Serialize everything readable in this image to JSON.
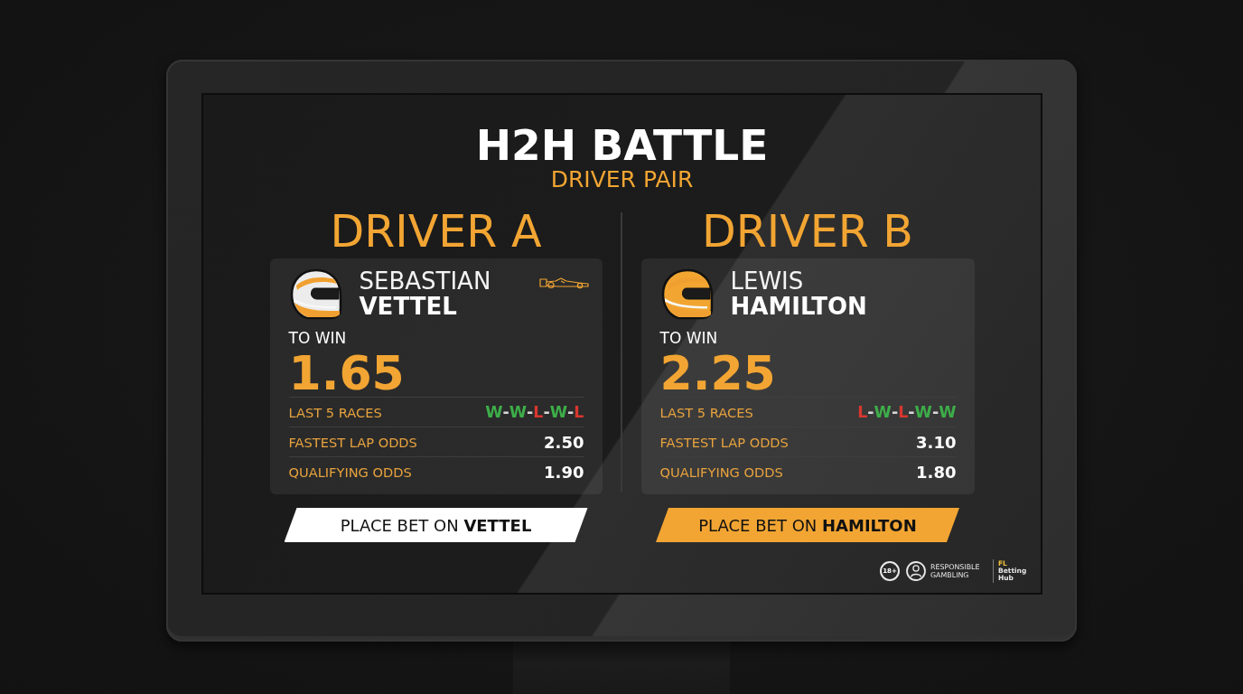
{
  "title": "H2H BATTLE",
  "subtitle": "DRIVER PAIR",
  "drivers": [
    {
      "heading": "DRIVER A",
      "first_name": "SEBASTIAN",
      "last_name": "VETTEL",
      "helmet": {
        "color": "#ececec"
      },
      "car_icon": true,
      "to_win_label": "TO WIN",
      "to_win_odds": "1.65",
      "stats": [
        {
          "kind": "form",
          "label": "LAST 5 RACES",
          "separator": "-",
          "results": [
            {
              "text": "W",
              "color": "#3dae49"
            },
            {
              "text": "W",
              "color": "#3dae49"
            },
            {
              "text": "L",
              "color": "#d8372f"
            },
            {
              "text": "W",
              "color": "#3dae49"
            },
            {
              "text": "L",
              "color": "#d8372f"
            }
          ]
        },
        {
          "kind": "odds",
          "label": "FASTEST LAP ODDS",
          "value": "2.50"
        },
        {
          "kind": "odds",
          "label": "QUALIFYING ODDS",
          "value": "1.90"
        }
      ],
      "bet_button": {
        "label": "PLACE BET ON **VETTEL**",
        "selected": false
      }
    },
    {
      "heading": "DRIVER B",
      "first_name": "LEWIS",
      "last_name": "HAMILTON",
      "helmet": {
        "color": "#f2a531"
      },
      "car_icon": false,
      "to_win_label": "TO WIN",
      "to_win_odds": "2.25",
      "stats": [
        {
          "kind": "form",
          "label": "LAST 5 RACES",
          "separator": "-",
          "results": [
            {
              "text": "L",
              "color": "#d8372f"
            },
            {
              "text": "W",
              "color": "#3dae49"
            },
            {
              "text": "L",
              "color": "#d8372f"
            },
            {
              "text": "W",
              "color": "#3dae49"
            },
            {
              "text": "W",
              "color": "#3dae49"
            }
          ]
        },
        {
          "kind": "odds",
          "label": "FASTEST LAP ODDS",
          "value": "3.10"
        },
        {
          "kind": "odds",
          "label": "QUALIFYING ODDS",
          "value": "1.80"
        }
      ],
      "bet_button": {
        "label": "PLACE BET ON **HAMILTON**",
        "selected": true
      }
    }
  ],
  "footer": {
    "age_badge": "18+",
    "responsible_gambling": "RESPONSIBLE GAMBLING",
    "brand_mark": "FL",
    "brand_name": "Betting Hub"
  }
}
